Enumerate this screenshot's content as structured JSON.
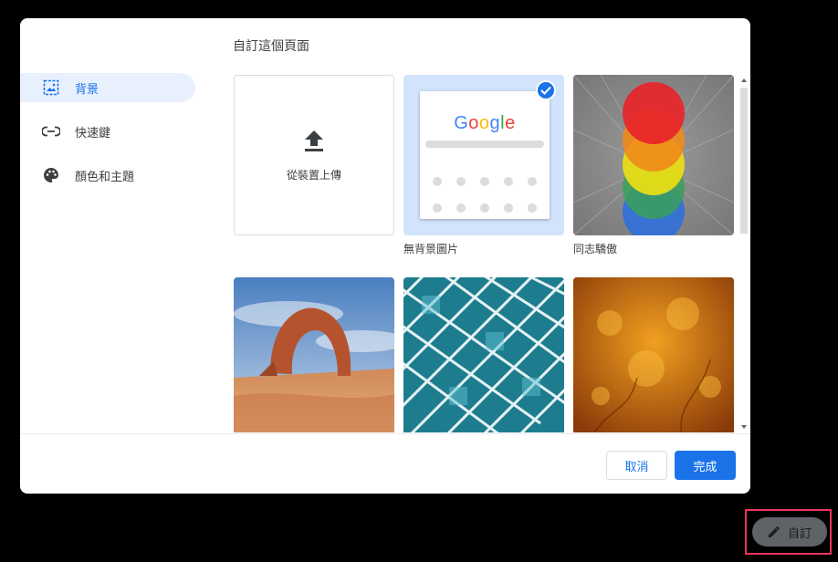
{
  "dialog": {
    "title": "自訂這個頁面",
    "sidebar": {
      "items": [
        {
          "label": "背景",
          "icon": "image-icon",
          "active": true
        },
        {
          "label": "快速鍵",
          "icon": "link-icon",
          "active": false
        },
        {
          "label": "顏色和主題",
          "icon": "palette-icon",
          "active": false
        }
      ]
    },
    "tiles": {
      "upload_label": "從裝置上傳",
      "no_background_label": "無背景圖片",
      "pride_label": "同志驕傲",
      "google_logo": [
        "G",
        "o",
        "o",
        "g",
        "l",
        "e"
      ]
    },
    "footer": {
      "cancel_label": "取消",
      "done_label": "完成"
    }
  },
  "customize_button": {
    "label": "自訂",
    "icon": "pencil-icon"
  },
  "colors": {
    "accent": "#1a73e8",
    "highlight_border": "#e8365b"
  }
}
